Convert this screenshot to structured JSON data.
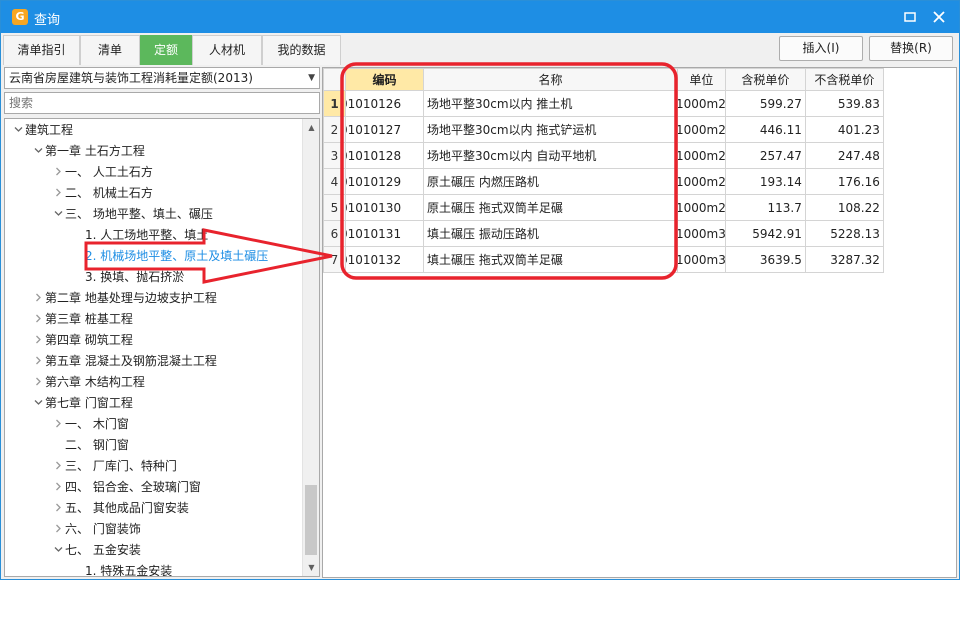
{
  "window": {
    "title": "查询",
    "app_icon_glyph": "G"
  },
  "tabs": [
    {
      "label": "清单指引",
      "active": false
    },
    {
      "label": "清单",
      "active": false
    },
    {
      "label": "定额",
      "active": true
    },
    {
      "label": "人材机",
      "active": false
    },
    {
      "label": "我的数据",
      "active": false
    }
  ],
  "actions": {
    "insert_label": "插入(I)",
    "replace_label": "替换(R)"
  },
  "library": {
    "selected": "云南省房屋建筑与装饰工程消耗量定额(2013)"
  },
  "search": {
    "placeholder": "搜索"
  },
  "tree": [
    {
      "label": "建筑工程",
      "level": 0,
      "toggle": "expanded"
    },
    {
      "label": "第一章 土石方工程",
      "level": 1,
      "toggle": "expanded"
    },
    {
      "label": "一、 人工土石方",
      "level": 2,
      "toggle": "collapsed"
    },
    {
      "label": "二、 机械土石方",
      "level": 2,
      "toggle": "collapsed"
    },
    {
      "label": "三、 场地平整、填土、碾压",
      "level": 2,
      "toggle": "expanded"
    },
    {
      "label": "1. 人工场地平整、填土",
      "level": 3,
      "toggle": "none"
    },
    {
      "label": "2. 机械场地平整、原土及填土碾压",
      "level": 3,
      "toggle": "none",
      "selected": true
    },
    {
      "label": "3. 换填、抛石挤淤",
      "level": 3,
      "toggle": "none"
    },
    {
      "label": "第二章 地基处理与边坡支护工程",
      "level": 1,
      "toggle": "collapsed"
    },
    {
      "label": "第三章 桩基工程",
      "level": 1,
      "toggle": "collapsed"
    },
    {
      "label": "第四章 砌筑工程",
      "level": 1,
      "toggle": "collapsed"
    },
    {
      "label": "第五章 混凝土及钢筋混凝土工程",
      "level": 1,
      "toggle": "collapsed"
    },
    {
      "label": "第六章 木结构工程",
      "level": 1,
      "toggle": "collapsed"
    },
    {
      "label": "第七章 门窗工程",
      "level": 1,
      "toggle": "expanded"
    },
    {
      "label": "一、 木门窗",
      "level": 2,
      "toggle": "collapsed"
    },
    {
      "label": "二、 钢门窗",
      "level": 2,
      "toggle": "none"
    },
    {
      "label": "三、 厂库门、特种门",
      "level": 2,
      "toggle": "collapsed"
    },
    {
      "label": "四、 铝合金、全玻璃门窗",
      "level": 2,
      "toggle": "collapsed"
    },
    {
      "label": "五、 其他成品门窗安装",
      "level": 2,
      "toggle": "collapsed"
    },
    {
      "label": "六、 门窗装饰",
      "level": 2,
      "toggle": "collapsed"
    },
    {
      "label": "七、 五金安装",
      "level": 2,
      "toggle": "expanded"
    },
    {
      "label": "1. 特殊五金安装",
      "level": 3,
      "toggle": "none"
    }
  ],
  "grid": {
    "columns": [
      "编码",
      "名称",
      "单位",
      "含税单价",
      "不含税单价"
    ],
    "rows": [
      {
        "no": "1",
        "code": "01010126",
        "name": "场地平整30cm以内 推土机",
        "unit": "1000m2",
        "tax_price": "599.27",
        "notax_price": "539.83"
      },
      {
        "no": "2",
        "code": "01010127",
        "name": "场地平整30cm以内 拖式铲运机",
        "unit": "1000m2",
        "tax_price": "446.11",
        "notax_price": "401.23"
      },
      {
        "no": "3",
        "code": "01010128",
        "name": "场地平整30cm以内 自动平地机",
        "unit": "1000m2",
        "tax_price": "257.47",
        "notax_price": "247.48"
      },
      {
        "no": "4",
        "code": "01010129",
        "name": "原土碾压 内燃压路机",
        "unit": "1000m2",
        "tax_price": "193.14",
        "notax_price": "176.16"
      },
      {
        "no": "5",
        "code": "01010130",
        "name": "原土碾压 拖式双筒羊足碾",
        "unit": "1000m2",
        "tax_price": "113.7",
        "notax_price": "108.22"
      },
      {
        "no": "6",
        "code": "01010131",
        "name": "填土碾压 振动压路机",
        "unit": "1000m3",
        "tax_price": "5942.91",
        "notax_price": "5228.13"
      },
      {
        "no": "7",
        "code": "01010132",
        "name": "填土碾压 拖式双筒羊足碾",
        "unit": "1000m3",
        "tax_price": "3639.5",
        "notax_price": "3287.32"
      }
    ]
  },
  "colors": {
    "titlebar": "#1e8ee4",
    "active_tab": "#5cb85c",
    "selected_node": "#1e8ee4",
    "annotation_red": "#e8232d",
    "header_highlight": "#ffe9a6"
  }
}
